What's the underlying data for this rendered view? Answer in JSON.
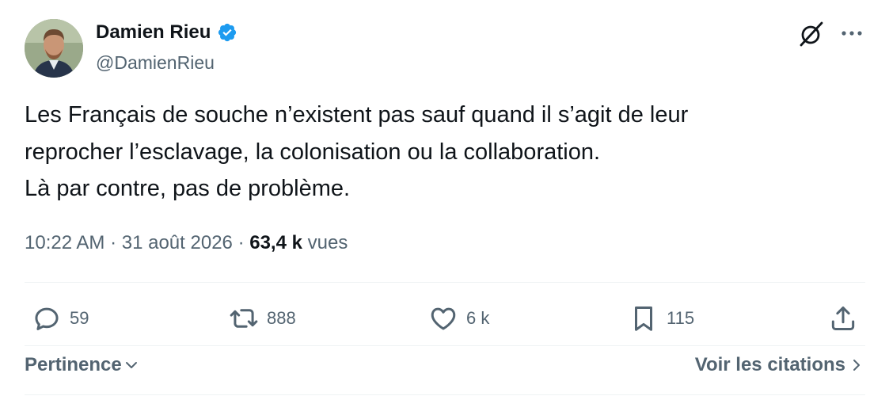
{
  "author": {
    "name": "Damien Rieu",
    "handle": "@DamienRieu",
    "verified": true
  },
  "tweet": {
    "lines": [
      "Les Français de souche n’existent pas sauf quand il s’agit de leur",
      "reprocher l’esclavage, la colonisation ou la collaboration.",
      "Là par contre, pas de problème."
    ]
  },
  "meta": {
    "time": "10:22 AM",
    "separator": "·",
    "date": "31 août 2026",
    "views_count": "63,4 k",
    "views_label": "vues"
  },
  "actions": {
    "replies": "59",
    "reposts": "888",
    "likes": "6 k",
    "bookmarks": "115"
  },
  "footer": {
    "sort_label": "Pertinence",
    "quotes_label": "Voir les citations"
  },
  "colors": {
    "text": "#0f1419",
    "secondary": "#536471",
    "verified": "#1d9bf0",
    "divider": "#eff3f4"
  },
  "icons": {
    "top_right": [
      "grok-icon",
      "more-icon"
    ],
    "actions": [
      "reply-icon",
      "repost-icon",
      "like-icon",
      "bookmark-icon",
      "share-icon"
    ]
  }
}
